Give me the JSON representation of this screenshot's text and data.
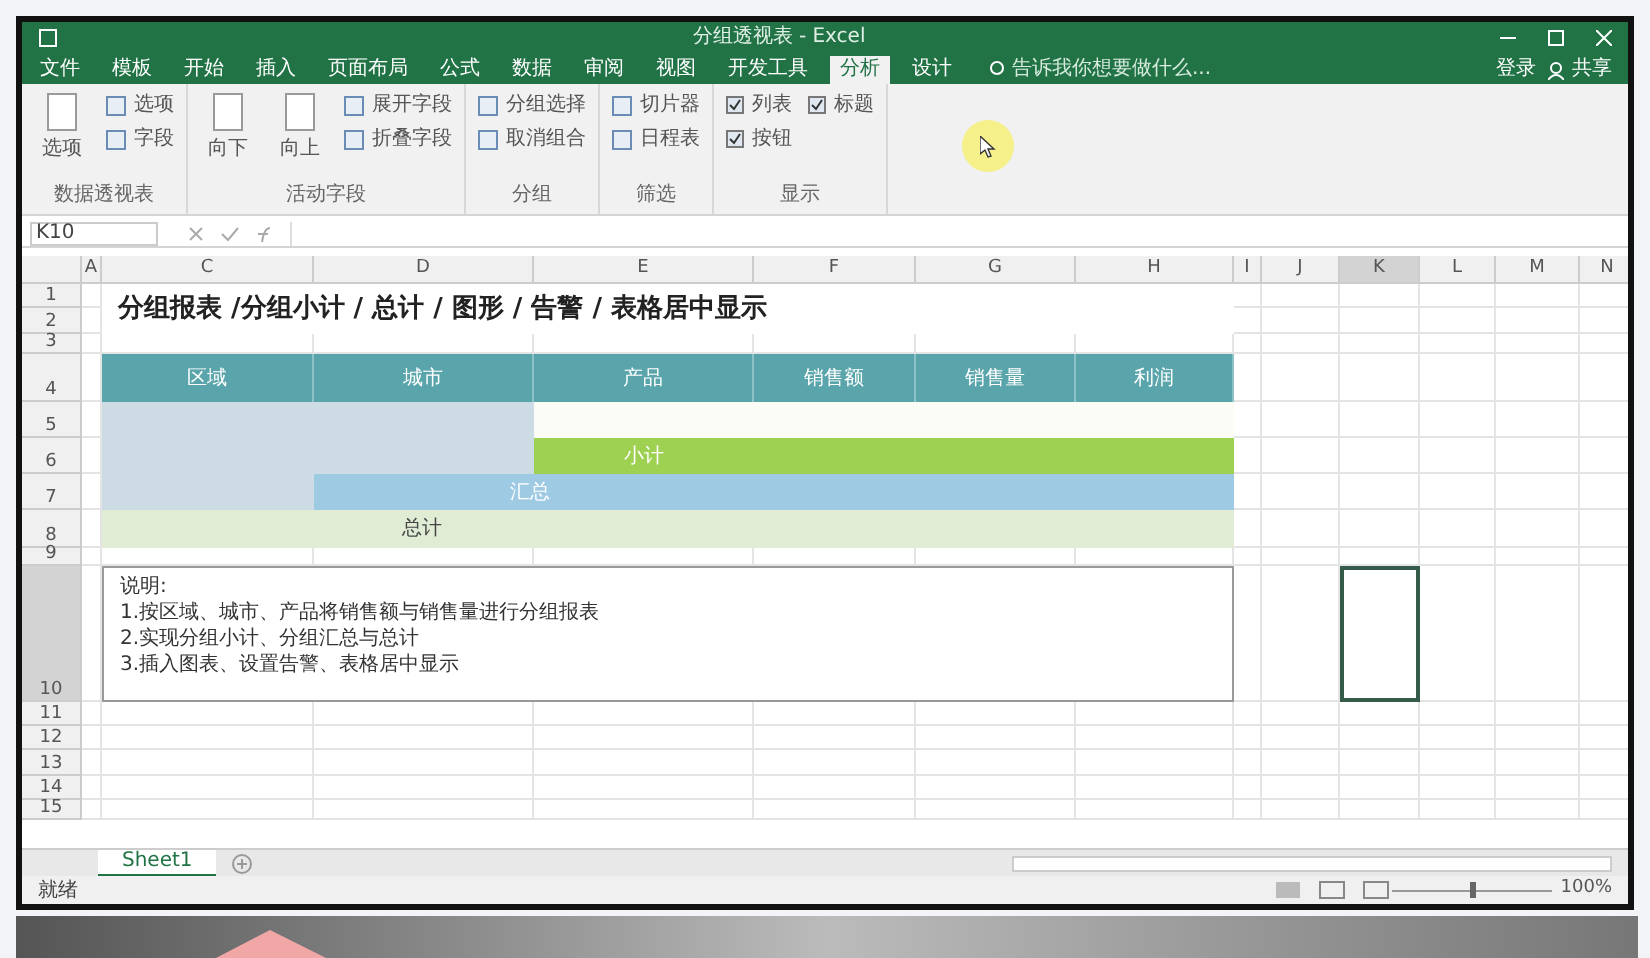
{
  "window": {
    "title": "分组透视表 - Excel",
    "account": "登录",
    "share": "共享"
  },
  "tabs": [
    {
      "label": "文件",
      "selected": false
    },
    {
      "label": "模板",
      "selected": false
    },
    {
      "label": "开始",
      "selected": false
    },
    {
      "label": "插入",
      "selected": false
    },
    {
      "label": "页面布局",
      "selected": false
    },
    {
      "label": "公式",
      "selected": false
    },
    {
      "label": "数据",
      "selected": false
    },
    {
      "label": "审阅",
      "selected": false
    },
    {
      "label": "视图",
      "selected": false
    },
    {
      "label": "开发工具",
      "selected": false
    },
    {
      "label": "分析",
      "selected": true
    },
    {
      "label": "设计",
      "selected": false
    }
  ],
  "tell_me": {
    "placeholder": "告诉我你想要做什么..."
  },
  "ribbon_groups": [
    {
      "label": "数据透视表",
      "items": [
        {
          "kind": "large",
          "text": "选项"
        },
        {
          "kind": "small",
          "text": "选项"
        },
        {
          "kind": "small",
          "text": "字段"
        }
      ]
    },
    {
      "label": "活动字段",
      "items": [
        {
          "kind": "large",
          "text": "向下"
        },
        {
          "kind": "large",
          "text": "向上"
        },
        {
          "kind": "small",
          "text": "展开字段"
        },
        {
          "kind": "small",
          "text": "折叠字段"
        }
      ]
    },
    {
      "label": "分组",
      "items": [
        {
          "kind": "small",
          "text": "分组选择"
        },
        {
          "kind": "small",
          "text": "取消组合"
        }
      ]
    },
    {
      "label": "筛选",
      "items": [
        {
          "kind": "small",
          "text": "切片器"
        },
        {
          "kind": "small",
          "text": "日程表"
        }
      ]
    },
    {
      "label": "显示",
      "items": [
        {
          "kind": "check",
          "text": "列表",
          "checked": true
        },
        {
          "kind": "check",
          "text": "按钮",
          "checked": true
        },
        {
          "kind": "check",
          "text": "标题",
          "checked": true
        }
      ]
    }
  ],
  "name_box": "K10",
  "columns": [
    "A",
    "C",
    "D",
    "E",
    "F",
    "G",
    "H",
    "I",
    "J",
    "K",
    "L",
    "M",
    "N"
  ],
  "rows": [
    "1",
    "2",
    "3",
    "4",
    "5",
    "6",
    "7",
    "8",
    "9",
    "10",
    "11",
    "12",
    "13",
    "14",
    "15"
  ],
  "sheet_title": "分组报表 /分组小计 / 总计 / 图形 / 告警 / 表格居中显示",
  "table_headers": [
    "区域",
    "城市",
    "产品",
    "销售额",
    "销售量",
    "利润"
  ],
  "subtotal_label": "小计",
  "group_total_label": "汇总",
  "grand_total_label": "总计",
  "notes": [
    "说明:",
    "1.按区域、城市、产品将销售额与销售量进行分组报表",
    "2.实现分组小计、分组汇总与总计",
    "3.插入图表、设置告警、表格居中显示"
  ],
  "sheet_tabs": [
    {
      "label": "Sheet1",
      "selected": true
    }
  ],
  "status": "就绪",
  "zoom_slider": {
    "level": 0.5
  },
  "zoom": "100%"
}
